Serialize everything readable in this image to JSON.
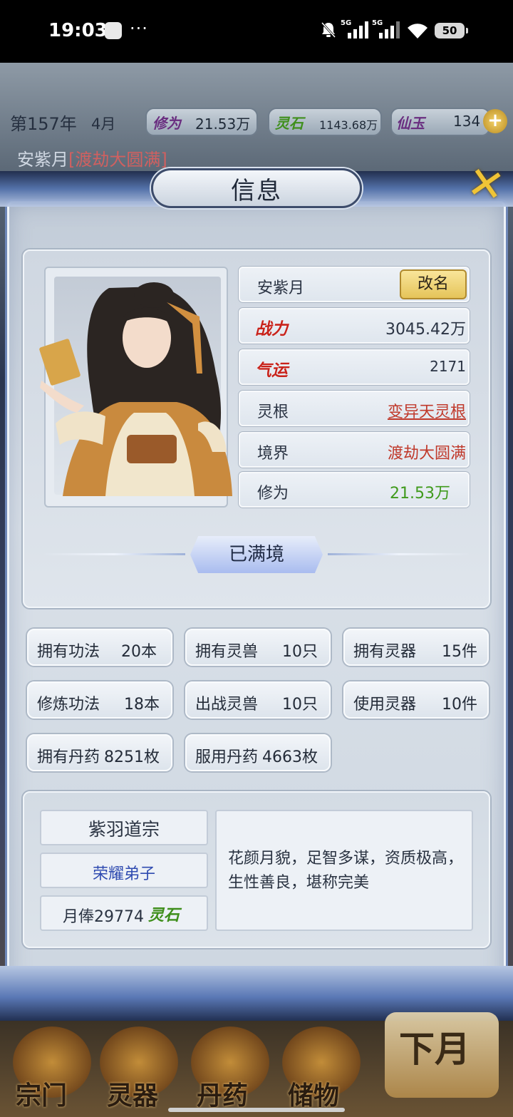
{
  "status_bar": {
    "time": "19:03",
    "dots": "···",
    "network_1": "5G",
    "network_2": "5G",
    "battery": "50"
  },
  "topbar": {
    "year": "第157年",
    "month": "4月",
    "cultivation_label": "修为",
    "cultivation_value": "21.53万",
    "spirit_stone_label": "灵石",
    "spirit_stone_value": "1143.68万",
    "jade_label": "仙玉",
    "jade_value": "134",
    "plus_icon": "plus-icon"
  },
  "hero_line": {
    "name": "安紫月",
    "realm": "[渡劫大圆满]"
  },
  "dialog": {
    "title": "信息",
    "close_icon": "close-icon"
  },
  "character": {
    "name": "安紫月",
    "rename_label": "改名",
    "rows": [
      {
        "label": "战力",
        "value": "3045.42万"
      },
      {
        "label": "气运",
        "value": "2171"
      },
      {
        "label": "灵根",
        "value": "变异天灵根"
      },
      {
        "label": "境界",
        "value": "渡劫大圆满"
      },
      {
        "label": "修为",
        "value": "21.53万"
      }
    ],
    "realm_button": "已满境"
  },
  "stats": [
    {
      "label": "拥有功法",
      "value": "20本"
    },
    {
      "label": "拥有灵兽",
      "value": "10只"
    },
    {
      "label": "拥有灵器",
      "value": "15件"
    },
    {
      "label": "修炼功法",
      "value": "18本"
    },
    {
      "label": "出战灵兽",
      "value": "10只"
    },
    {
      "label": "使用灵器",
      "value": "10件"
    },
    {
      "label": "拥有丹药",
      "value": "8251枚"
    },
    {
      "label": "服用丹药",
      "value": "4663枚"
    }
  ],
  "sect": {
    "name": "紫羽道宗",
    "rank": "荣耀弟子",
    "salary_prefix": "月俸29774",
    "salary_unit": "灵石",
    "description": "花颜月貌，足智多谋，资质极高，生性善良，堪称完美"
  },
  "bottom_nav": {
    "items": [
      "宗门",
      "灵器",
      "丹药",
      "储物"
    ],
    "next_month": "下月"
  },
  "colors": {
    "accent_gold": "#e5c45a",
    "art_red": "#c8221a",
    "cultivation_green": "#3f9a1c",
    "rank_blue": "#2f4bb0"
  }
}
